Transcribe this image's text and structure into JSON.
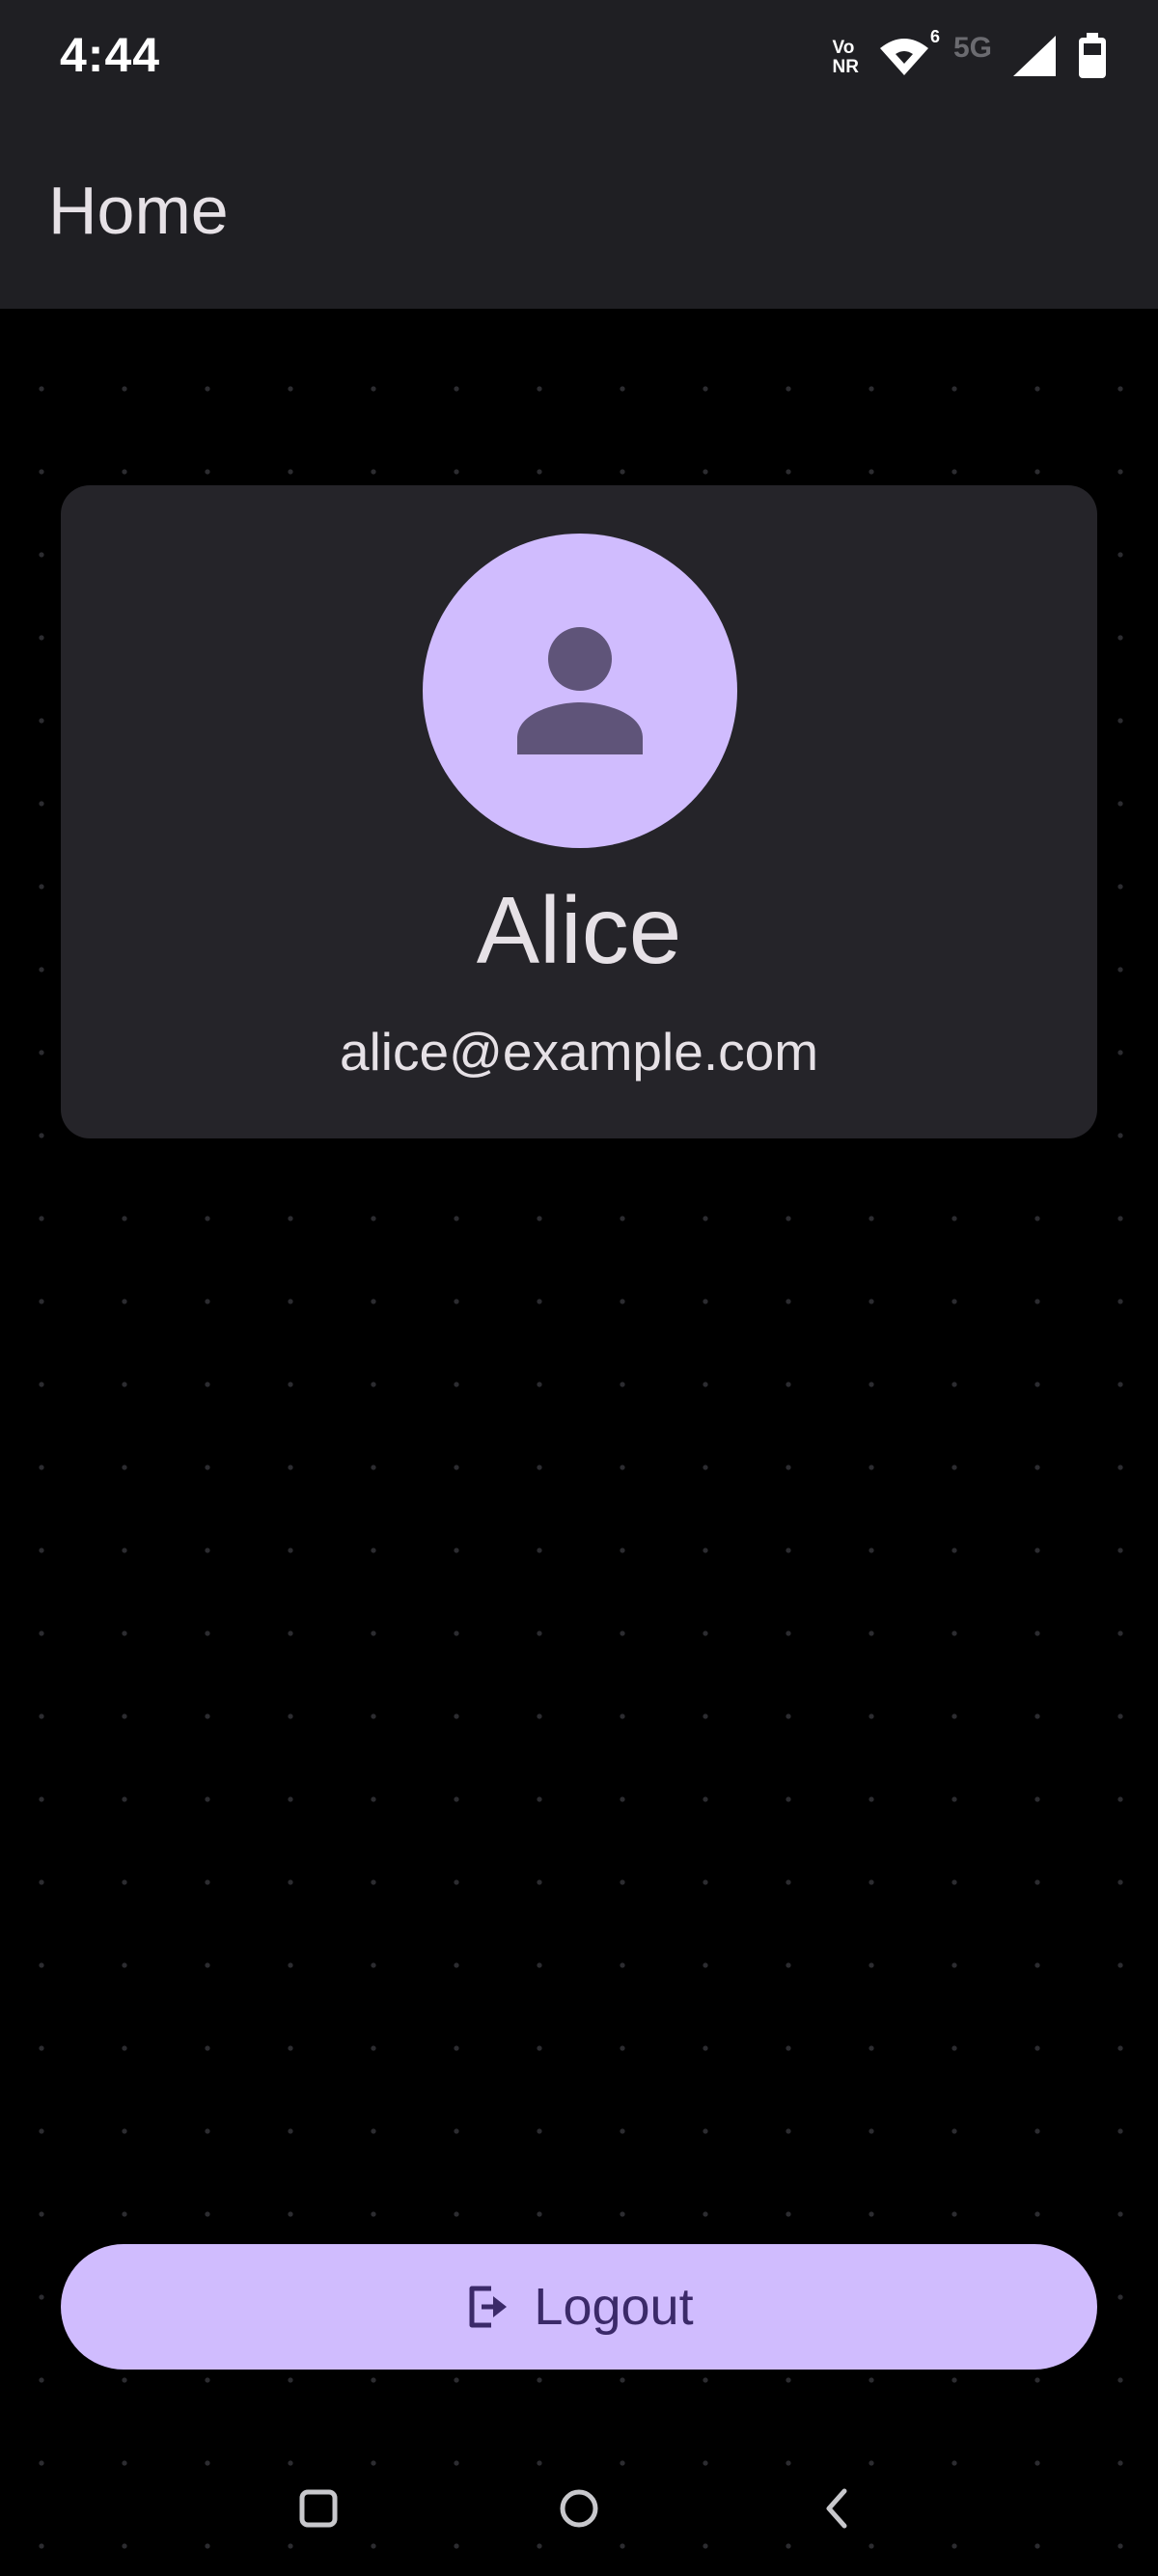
{
  "status_bar": {
    "time": "4:44",
    "vonr_top": "Vo",
    "vonr_bottom": "NR",
    "wifi_badge": "6",
    "network": "5G",
    "icons": [
      "vonr-icon",
      "wifi-icon",
      "network-5g-icon",
      "signal-icon",
      "battery-icon"
    ]
  },
  "app_bar": {
    "title": "Home"
  },
  "profile": {
    "avatar_icon": "person-icon",
    "name": "Alice",
    "email": "alice@example.com"
  },
  "actions": {
    "logout_label": "Logout",
    "logout_icon": "logout-icon"
  },
  "nav_bar": {
    "items": [
      "recents-icon",
      "home-icon",
      "back-icon"
    ]
  },
  "colors": {
    "background": "#000000",
    "surface": "#1f1f23",
    "card": "#252429",
    "accent": "#d0bcfe",
    "on_accent": "#3b2a69",
    "avatar_glyph": "#5f5479",
    "text": "#e6e1e6"
  }
}
